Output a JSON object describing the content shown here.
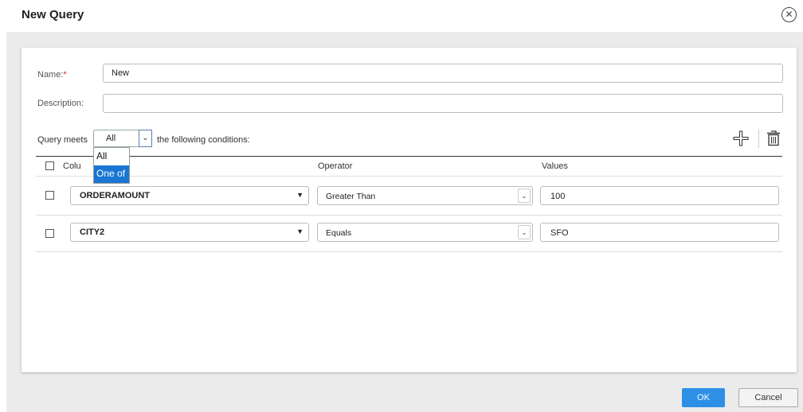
{
  "dialog": {
    "title": "New Query",
    "close_icon": "close-circle-icon"
  },
  "form": {
    "name_label": "Name:",
    "required_marker": "*",
    "name_value": "New",
    "description_label": "Description:",
    "description_value": ""
  },
  "query_meets": {
    "prefix": "Query meets",
    "selected": "All",
    "suffix": "the following conditions:",
    "options": [
      "All",
      "One of"
    ],
    "highlighted_option": "One of"
  },
  "toolbar": {
    "add_icon": "plus-icon",
    "delete_icon": "trash-icon"
  },
  "table": {
    "columns": [
      "Colu",
      "Operator",
      "Values"
    ],
    "rows": [
      {
        "column": "ORDERAMOUNT",
        "operator": "Greater Than",
        "value": "100"
      },
      {
        "column": "CITY2",
        "operator": "Equals",
        "value": "SFO"
      }
    ]
  },
  "footer": {
    "ok_label": "OK",
    "cancel_label": "Cancel"
  },
  "colors": {
    "accent": "#2d8fe6",
    "highlight": "#1976d2",
    "required": "#e02020"
  }
}
